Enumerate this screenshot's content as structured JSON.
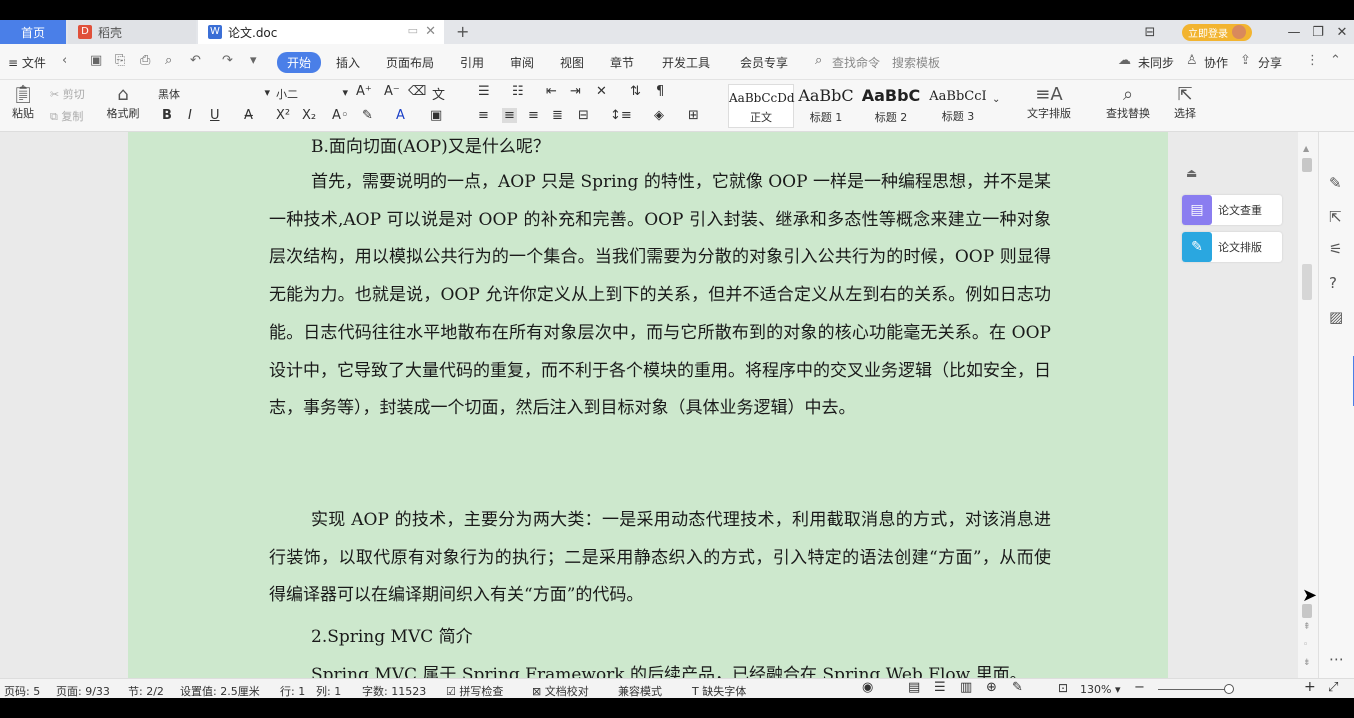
{
  "tabs": {
    "home": "首页",
    "daoke": "稻壳",
    "doc": "论文.doc",
    "add": "+"
  },
  "account": {
    "badge": "立即登录"
  },
  "window_buttons": {
    "layout": "⊟",
    "minimize": "—",
    "restore": "❐",
    "close": "✕"
  },
  "menu": {
    "file": "≡ 文件",
    "items": [
      "开始",
      "插入",
      "页面布局",
      "引用",
      "审阅",
      "视图",
      "章节",
      "开发工具",
      "会员专享"
    ],
    "search": "查找命令",
    "search_template": "搜索模板",
    "right": {
      "sync": "未同步",
      "collab": "协作",
      "share": "分享"
    }
  },
  "ribbon": {
    "paste": "粘贴",
    "cut": "剪切",
    "copy": "复制",
    "format_painter": "格式刷",
    "font_name": "黑体",
    "font_size": "小二",
    "styles": [
      {
        "sample": "AaBbCcDd",
        "label": "正文"
      },
      {
        "sample": "AaBbC",
        "label": "标题 1"
      },
      {
        "sample": "AaBbC",
        "label": "标题 2"
      },
      {
        "sample": "AaBbCcI",
        "label": "标题 3"
      }
    ],
    "text_layout": "文字排版",
    "find_replace": "查找替换",
    "select": "选择"
  },
  "document": {
    "line0": "B.面向切面(AOP)又是什么呢？",
    "para1": "首先，需要说明的一点，AOP 只是 Spring 的特性，它就像 OOP 一样是一种编程思想，并不是某一种技术,AOP 可以说是对 OOP 的补充和完善。OOP 引入封装、继承和多态性等概念来建立一种对象层次结构，用以模拟公共行为的一个集合。当我们需要为分散的对象引入公共行为的时候，OOP 则显得无能为力。也就是说，OOP 允许你定义从上到下的关系，但并不适合定义从左到右的关系。例如日志功能。日志代码往往水平地散布在所有对象层次中，而与它所散布到的对象的核心功能毫无关系。在 OOP 设计中，它导致了大量代码的重复，而不利于各个模块的重用。将程序中的交叉业务逻辑（比如安全，日志，事务等），封装成一个切面，然后注入到目标对象（具体业务逻辑）中去。",
    "para2": "实现 AOP 的技术，主要分为两大类：一是采用动态代理技术，利用截取消息的方式，对该消息进行装饰，以取代原有对象行为的执行；二是采用静态织入的方式，引入特定的语法创建“方面”，从而使得编译器可以在编译期间织入有关“方面”的代码。",
    "heading2": "2.Spring MVC 简介",
    "para3": "Spring MVC 属于 Spring Framework 的后续产品，已经融合在 Spring Web Flow 里面。"
  },
  "side_panel": {
    "check": "论文查重",
    "layout": "论文排版"
  },
  "status": {
    "page_code": "页码: 5",
    "page": "页面: 9/33",
    "section": "节: 2/2",
    "setting": "设置值: 2.5厘米",
    "row": "行: 1",
    "col": "列: 1",
    "words": "字数: 11523",
    "spell": "拼写检查",
    "proof": "文档校对",
    "compat": "兼容模式",
    "missing_font": "缺失字体",
    "zoom": "130%"
  },
  "colors": {
    "accent": "#4a7fe8",
    "page_bg": "#cde8cd",
    "vip": "#f2b430"
  }
}
